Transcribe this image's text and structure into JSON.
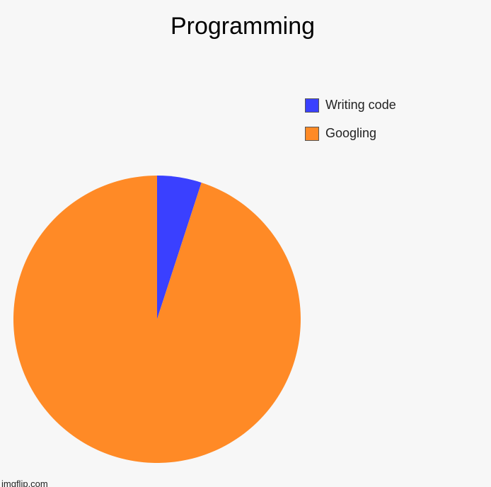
{
  "chart_data": {
    "type": "pie",
    "title": "Programming",
    "slices": [
      {
        "label": "Writing code",
        "value": 5,
        "color": "#3a40ff"
      },
      {
        "label": "Googling",
        "value": 95,
        "color": "#ff8a26"
      }
    ],
    "legend_position": "top-right"
  },
  "watermark": "imgflip.com"
}
